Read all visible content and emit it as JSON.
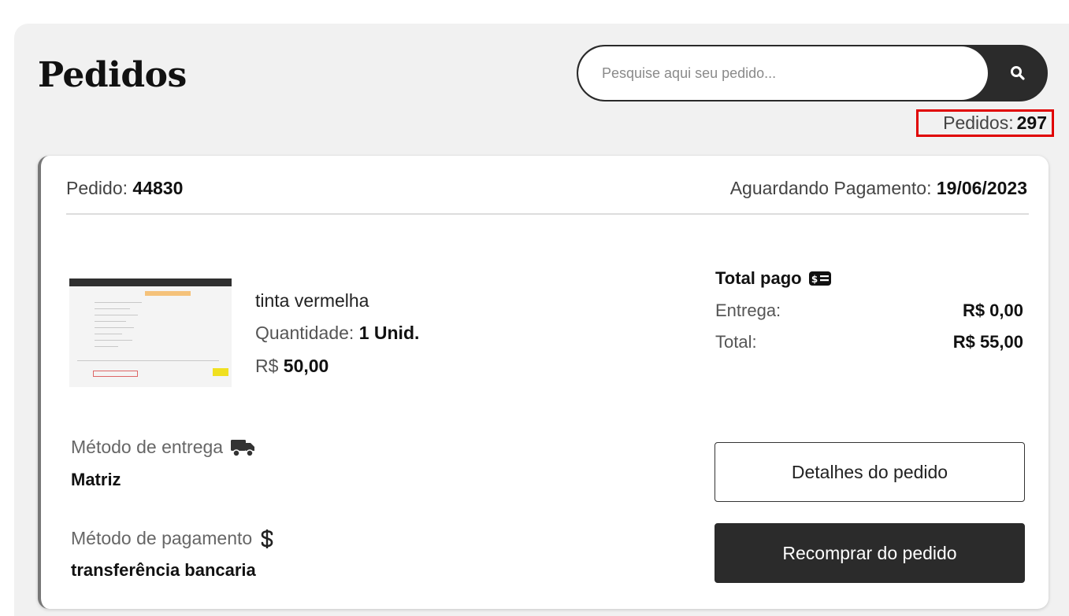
{
  "header": {
    "title": "Pedidos",
    "search": {
      "placeholder": "Pesquise aqui seu pedido...",
      "value": ""
    },
    "count_label": "Pedidos:",
    "count_value": "297"
  },
  "order": {
    "id_label": "Pedido:",
    "id_value": "44830",
    "status_label": "Aguardando Pagamento:",
    "status_date": "19/06/2023",
    "item": {
      "name": "tinta vermelha",
      "qty_label": "Quantidade:",
      "qty_value": "1 Unid.",
      "price_prefix": "R$",
      "price_value": "50,00"
    },
    "summary": {
      "title": "Total pago",
      "delivery_label": "Entrega:",
      "delivery_value": "R$ 0,00",
      "total_label": "Total:",
      "total_value": "R$ 55,00"
    },
    "delivery_method": {
      "label": "Método de entrega",
      "value": "Matriz"
    },
    "payment_method": {
      "label": "Método de pagamento",
      "value": "transferência bancaria"
    },
    "buttons": {
      "details": "Detalhes do pedido",
      "rebuy": "Recomprar do pedido"
    }
  },
  "icons": [
    "search-icon",
    "money-bill-icon",
    "truck-icon",
    "dollar-icon"
  ],
  "colors": {
    "primary_dark": "#2b2b2b",
    "highlight_red": "#e00000",
    "panel_bg": "#f1f1f1"
  }
}
